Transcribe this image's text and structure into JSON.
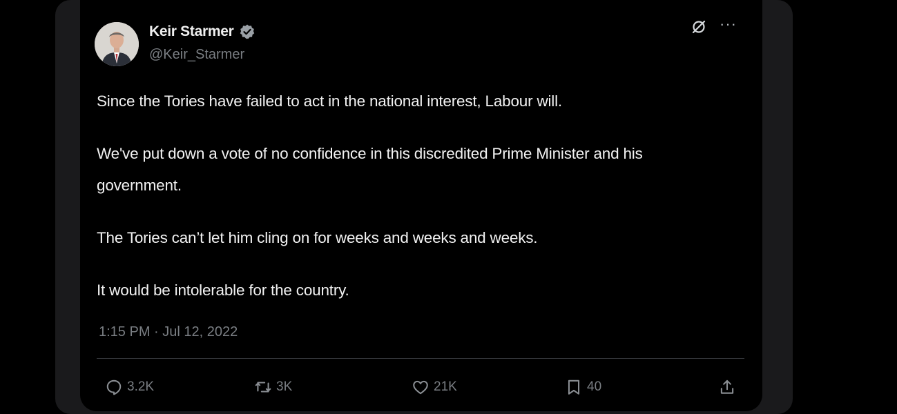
{
  "author": {
    "display_name": "Keir Starmer",
    "handle": "@Keir_Starmer",
    "verified": true,
    "verified_color": "#1d9bf0"
  },
  "tweet": {
    "paragraphs": [
      "Since the Tories have failed to act in the national interest, Labour will.",
      "We've put down a vote of no confidence in this discredited Prime Minister and his government.",
      "The Tories can’t let him cling on for weeks and weeks and weeks.",
      "It would be intolerable for the country."
    ],
    "timestamp": "1:15 PM · Jul 12, 2022"
  },
  "actions": {
    "replies": "3.2K",
    "reposts": "3K",
    "likes": "21K",
    "bookmarks": "40"
  },
  "icons": {
    "header": [
      "grok-icon",
      "more-icon"
    ],
    "actions": [
      "reply-icon",
      "repost-icon",
      "like-icon",
      "bookmark-icon",
      "share-icon"
    ]
  },
  "colors": {
    "background": "#000000",
    "text": "#f2f2f2",
    "muted": "#7a7e83"
  }
}
